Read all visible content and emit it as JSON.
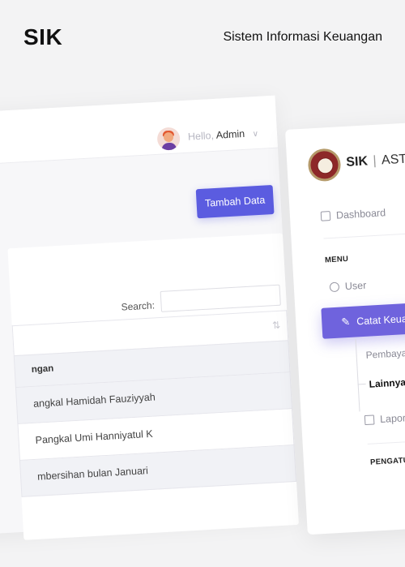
{
  "header": {
    "brand": "SIK",
    "tagline": "Sistem Informasi Keuangan"
  },
  "left_screen": {
    "greeting_prefix": "Hello,",
    "greeting_user": "Admin",
    "add_button": "Tambah Data",
    "search_label": "Search:",
    "search_value": "",
    "column_header": "ngan",
    "rows": [
      "angkal Hamidah Fauziyyah",
      "Pangkal Umi Hanniyatul K",
      "mbersihan bulan Januari"
    ]
  },
  "right_screen": {
    "logo_brand": "SIK",
    "logo_separator": "|",
    "logo_sub": "ASTR",
    "nav_dashboard": "Dashboard",
    "section_menu": "MENU",
    "nav_user": "User",
    "nav_catat": "Catat Keuan",
    "sub_pembayaran": "Pembayaran",
    "sub_lainnya": "Lainnya",
    "nav_laporan": "Laporan",
    "section_pengaturan": "PENGATURAN"
  },
  "colors": {
    "accent": "#5b5ce0",
    "sidebar_active": "#6f63dd",
    "background": "#f3f3f4"
  }
}
